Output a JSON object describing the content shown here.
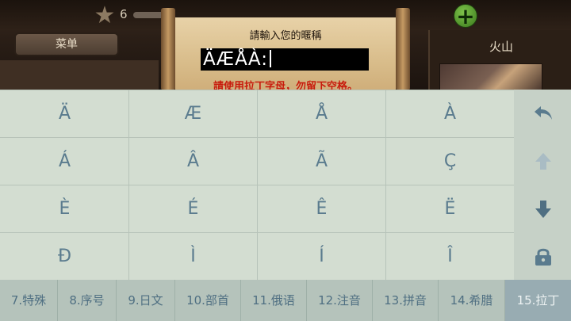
{
  "game": {
    "level": "6",
    "menu_label": "菜单",
    "volcano_title": "火山"
  },
  "dialog": {
    "title": "請輸入您的暱稱",
    "input_value": "ÄÆÅÀ:",
    "hint": "請使用拉丁字母，勿留下空格。"
  },
  "keyboard": {
    "rows": [
      [
        "Ä",
        "Æ",
        "Å",
        "À"
      ],
      [
        "Á",
        "Â",
        "Ã",
        "Ç"
      ],
      [
        "È",
        "É",
        "Ê",
        "Ë"
      ],
      [
        "Đ",
        "Ì",
        "Í",
        "Î"
      ]
    ],
    "side_keys": [
      "backspace-icon",
      "shift-up-icon",
      "enter-down-icon",
      "lock-icon"
    ],
    "tabs": [
      "7.特殊",
      "8.序号",
      "9.日文",
      "10.部首",
      "11.俄语",
      "12.注音",
      "13.拼音",
      "14.希腊",
      "15.拉丁"
    ],
    "active_tab": "15.拉丁",
    "colors": {
      "key_text": "#5a7b8e",
      "key_bg": "#d3ddd1",
      "tab_bg": "#b5c3bb",
      "tab_active_bg": "#98acb2"
    }
  }
}
